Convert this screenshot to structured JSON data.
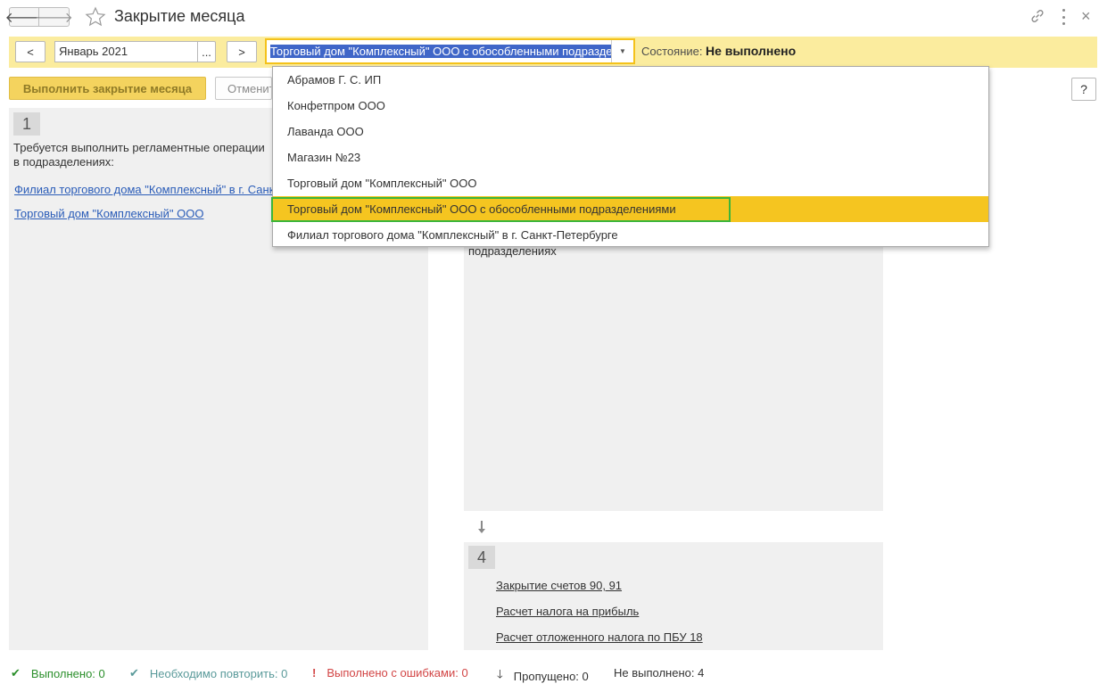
{
  "window": {
    "title": "Закрытие месяца",
    "back_glyph": "🡐",
    "forward_glyph": "🡒",
    "close_glyph": "×"
  },
  "filter": {
    "prev_label": "<",
    "next_label": ">",
    "period_value": "Январь 2021",
    "period_choose_label": "...",
    "organization_value": "Торговый дом \"Комплексный\" ООО с обособленными подразде",
    "state_label": "Состояние:",
    "state_value": "Не выполнено"
  },
  "commands": {
    "run_label": "Выполнить закрытие месяца",
    "cancel_label": "Отменить",
    "help_label": "?"
  },
  "step1": {
    "number": "1",
    "text": "Требуется выполнить регламентные операции в подразделениях:",
    "links": [
      "Филиал торгового дома \"Комплексный\" в г. Санкт-Петербурге",
      "Торговый дом \"Комплексный\" ООО"
    ]
  },
  "step3": {
    "text_fragment": "подразделениях"
  },
  "step4": {
    "number": "4",
    "links": [
      "Закрытие счетов 90, 91",
      "Расчет налога на прибыль",
      "Расчет отложенного налога по ПБУ 18"
    ]
  },
  "dropdown": {
    "items": [
      "Абрамов Г. С. ИП",
      "Конфетпром ООО",
      "Лаванда ООО",
      "Магазин №23",
      "Торговый дом \"Комплексный\" ООО",
      "Торговый дом \"Комплексный\" ООО с обособленными подразделениями",
      "Филиал торгового дома \"Комплексный\" в г. Санкт-Петербурге"
    ],
    "selected_index": 5
  },
  "statusbar": {
    "done": "Выполнено: 0",
    "repeat": "Необходимо повторить: 0",
    "errors": "Выполнено с ошибками: 0",
    "skipped": "Пропущено: 0",
    "not_done": "Не выполнено: 4",
    "check_glyph": "✔",
    "error_glyph": "!",
    "skip_glyph": "🡓"
  },
  "colors": {
    "accent_yellow": "#fbec9e",
    "selected_yellow": "#f5c520",
    "link_blue": "#2a5cb8",
    "done_green": "#2b8f2b",
    "error_red": "#d24545"
  }
}
